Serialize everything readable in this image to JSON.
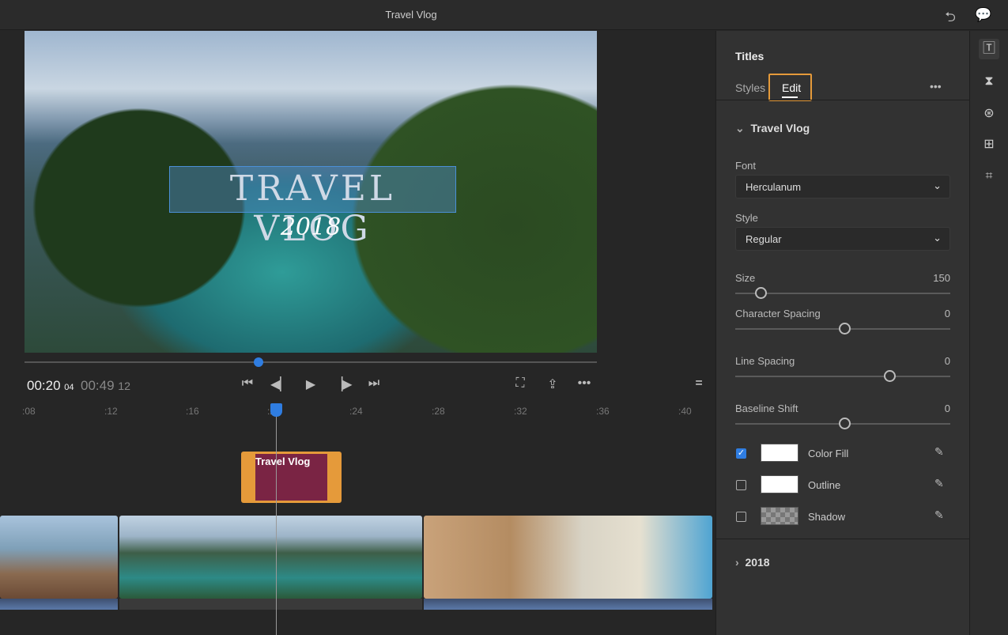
{
  "window": {
    "title": "Travel Vlog",
    "icons": [
      "undo-icon",
      "comment-icon"
    ]
  },
  "preview": {
    "title_main": "TRAVEL VLOG",
    "title_sub": "2018"
  },
  "transport": {
    "current_time": "00:20",
    "current_frames": "04",
    "total_time": "00:49",
    "total_frames": "12",
    "scrub_progress": 0.41,
    "icons": [
      "go-to-start-icon",
      "step-back-icon",
      "play-icon",
      "step-forward-icon",
      "go-to-end-icon",
      "fit-icon",
      "share-icon",
      "more-icon",
      "menu-icon"
    ]
  },
  "timeline": {
    "ruler": [
      ":08",
      ":12",
      ":16",
      ":20",
      ":24",
      ":28",
      ":32",
      ":36",
      ":40"
    ],
    "title_clip": "Travel Vlog",
    "playhead": ":20"
  },
  "panel": {
    "header": "Titles",
    "tabs": [
      "Styles",
      "Edit"
    ],
    "active_tab": "Edit",
    "section1": "Travel Vlog",
    "font_label": "Font",
    "font_value": "Herculanum",
    "style_label": "Style",
    "style_value": "Regular",
    "sliders": [
      {
        "label": "Size",
        "value": "150"
      },
      {
        "label": "Character Spacing",
        "value": "0"
      },
      {
        "label": "Line Spacing",
        "value": "0"
      },
      {
        "label": "Baseline Shift",
        "value": "0"
      }
    ],
    "fills": [
      {
        "label": "Color Fill",
        "checked": true,
        "color": "#ffffff"
      },
      {
        "label": "Outline",
        "checked": false,
        "color": "#ffffff"
      },
      {
        "label": "Shadow",
        "checked": false,
        "color": "transparent"
      }
    ],
    "section2": "2018"
  },
  "rail": {
    "icons": [
      "titles-icon",
      "transitions-icon",
      "color-icon",
      "audio-icon",
      "crop-icon"
    ]
  },
  "colors": {
    "accent": "#2f7de1",
    "highlight": "#e59a3a",
    "title_clip": "#7a2444"
  }
}
